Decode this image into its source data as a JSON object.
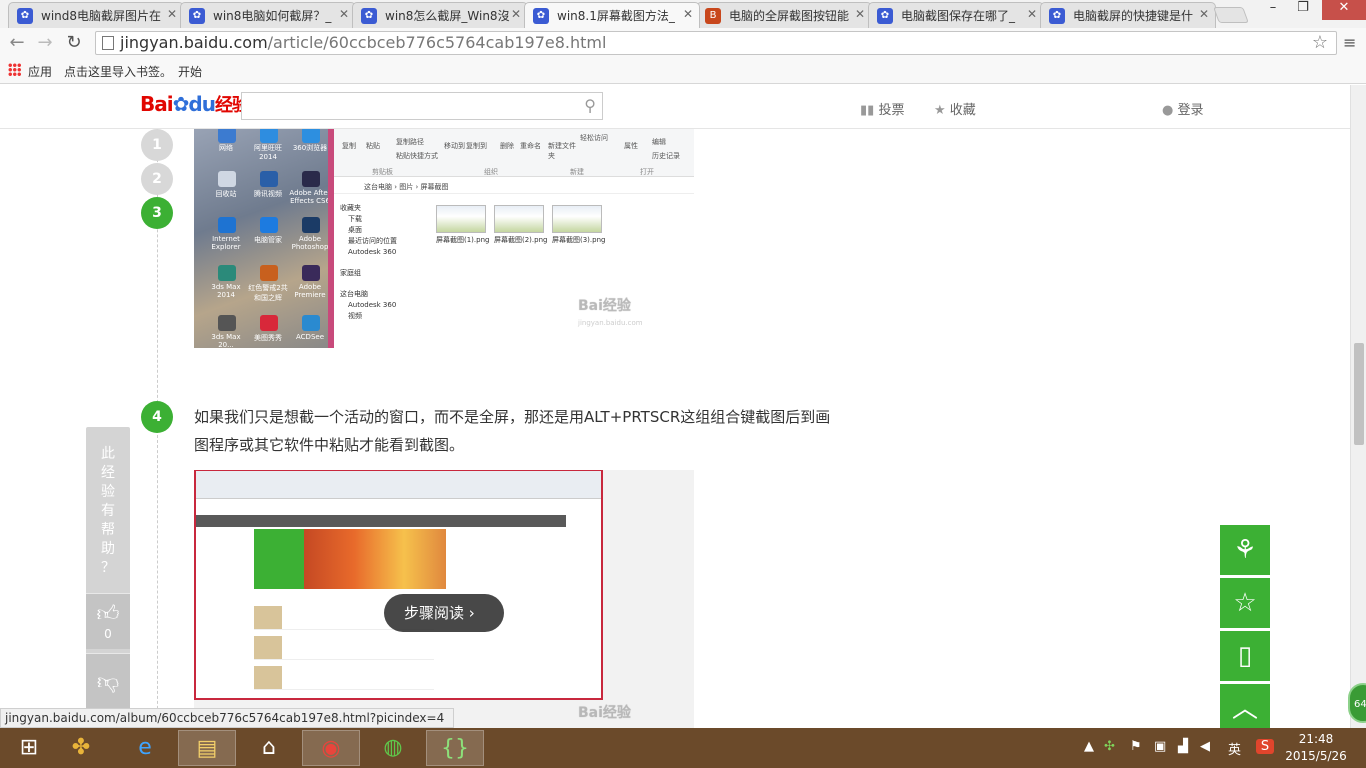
{
  "tabs": [
    {
      "title": "wind8电脑截屏图片在",
      "icon": "paw",
      "active": false
    },
    {
      "title": "win8电脑如何截屏？_",
      "icon": "paw",
      "active": false
    },
    {
      "title": "win8怎么截屏_Win8沒",
      "icon": "paw",
      "active": false
    },
    {
      "title": "win8.1屏幕截图方法_",
      "icon": "paw",
      "active": true
    },
    {
      "title": "电脑的全屏截图按钮能",
      "icon": "b",
      "active": false
    },
    {
      "title": "电脑截图保存在哪了_",
      "icon": "paw",
      "active": false
    },
    {
      "title": "电脑截屏的快捷键是什",
      "icon": "paw",
      "active": false
    }
  ],
  "window": {
    "minimize": "–",
    "restore": "❐",
    "close": "✕"
  },
  "omnibox": {
    "domain": "jingyan.baidu.com",
    "path": "/article/60ccbceb776c5764cab197e8.html"
  },
  "bookmarks": {
    "apps": "应用",
    "import": "点击这里导入书签。",
    "start": "开始"
  },
  "header": {
    "logo_bai": "Bai",
    "logo_du": "du",
    "logo_jy": "经验",
    "vote": "投票",
    "favorite": "收藏",
    "login": "登录"
  },
  "steps": [
    "1",
    "2",
    "3",
    "4"
  ],
  "step4_text": "如果我们只是想截一个活动的窗口，而不是全屏，那还是用ALT+PRTSCR这组组合键截图后到画图程序或其它软件中粘贴才能看到截图。",
  "img1": {
    "desktop_labels": [
      "网络",
      "阿里旺旺2014",
      "360浏览器",
      "回收站",
      "腾讯视频",
      "Adobe After Effects CS6",
      "Internet Explorer",
      "电脑管家",
      "Adobe Photoshop",
      "3ds Max 2014",
      "红色警戒2共和国之辉",
      "Adobe Premiere",
      "3ds Max 20...",
      "美图秀秀",
      "ACDSee"
    ],
    "ribbon_groups": [
      "剪贴板",
      "组织",
      "新建",
      "打开"
    ],
    "ribbon_items": [
      "复制",
      "粘贴",
      "复制路径",
      "粘贴快捷方式",
      "移动到",
      "复制到",
      "删除",
      "重命名",
      "新建文件夹",
      "轻松访问",
      "属性",
      "编辑",
      "历史记录"
    ],
    "address": "这台电脑 › 图片 › 屏幕截图",
    "nav": [
      "收藏夹",
      "下载",
      "桌面",
      "最近访问的位置",
      "Autodesk 360",
      "家庭组",
      "这台电脑",
      "Autodesk 360",
      "视频"
    ],
    "files": [
      "屏幕截图(1).png",
      "屏幕截图(2).png",
      "屏幕截图(3).png"
    ],
    "watermark": "Bai经验",
    "watermark_sub": "jingyan.baidu.com"
  },
  "img2": {
    "watermark": "Bai经验"
  },
  "read_pill": "步骤阅读",
  "vote_widget": {
    "text": [
      "此",
      "经",
      "验",
      "有",
      "帮",
      "助",
      "？"
    ],
    "likes": "0"
  },
  "status_url": "jingyan.baidu.com/album/60ccbceb776c5764cab197e8.html?picindex=4",
  "float_buttons": [
    "share-icon",
    "star-icon",
    "bookmark-icon",
    "back-to-top-icon"
  ],
  "badge": "64",
  "taskbar": {
    "ime": "英",
    "time": "21:48",
    "date": "2015/5/26"
  }
}
